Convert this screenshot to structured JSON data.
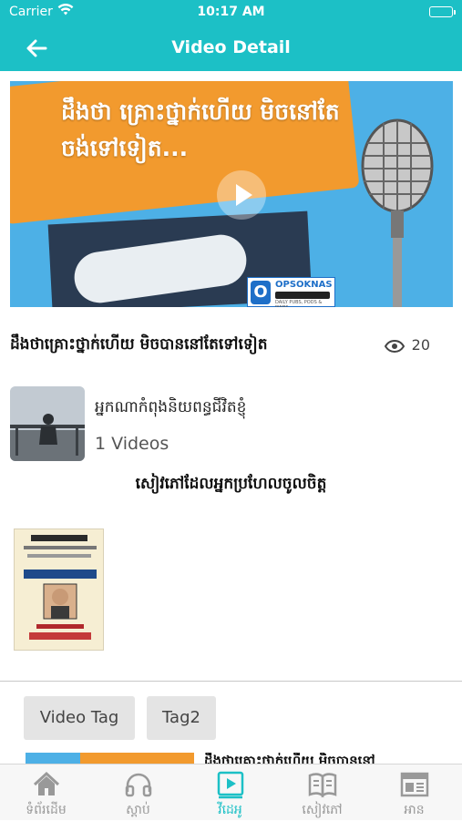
{
  "status_bar": {
    "carrier": "Carrier",
    "time": "10:17 AM"
  },
  "nav": {
    "title": "Video Detail"
  },
  "hero": {
    "overlay_text": "ដឹងថា គ្រោះថ្នាក់ហើយ មិចនៅតែចង់ទៅទៀត...",
    "brand_name": "OPSOKNAS",
    "brand_tagline": "DAILY PUBS, PODS & PINES"
  },
  "video": {
    "title": "ដឹងថាគ្រោះថ្នាក់ហើយ មិចបាននៅតែទៅទៀត",
    "views": "20"
  },
  "author": {
    "name": "អ្នកណាកំពុងនិយពន្ធជីវិតខ្ញុំ",
    "count": "1 Videos"
  },
  "books": {
    "heading": "សៀវភៅដែលអ្នកប្រហែលចូលចិត្ត"
  },
  "tags": [
    {
      "label": "Video Tag"
    },
    {
      "label": "Tag2"
    }
  ],
  "related": {
    "title": "ដឹងថាគ្រោះថ្នាក់ហើយ មិចបាននៅ"
  },
  "tabs": [
    {
      "label": "ទំព័រដើម",
      "icon": "home-icon"
    },
    {
      "label": "ស្តាប់",
      "icon": "headphones-icon"
    },
    {
      "label": "វីដេអូ",
      "icon": "video-icon"
    },
    {
      "label": "សៀវភៅ",
      "icon": "book-icon"
    },
    {
      "label": "អាន",
      "icon": "news-icon"
    }
  ],
  "colors": {
    "accent": "#1cc0c6",
    "inactive": "#999999"
  }
}
